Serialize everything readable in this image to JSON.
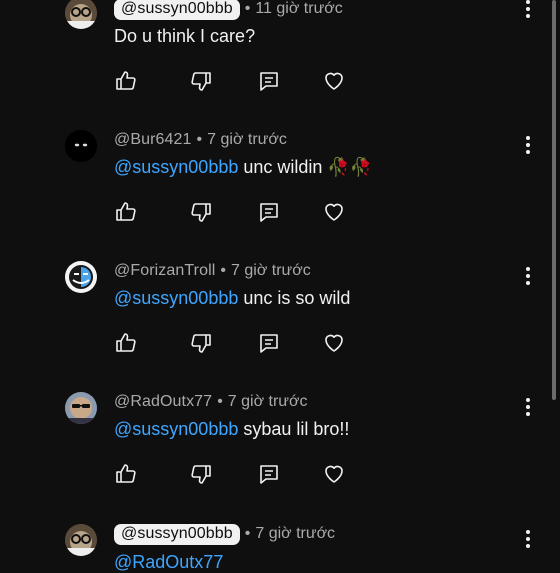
{
  "comments": [
    {
      "handle": "@sussyn00bbb",
      "handle_pill": true,
      "time": "11 giờ trước",
      "text": "Do u think I care?",
      "mention": "",
      "avatar": "avatar-glasses-cat"
    },
    {
      "handle": "@Bur6421",
      "handle_pill": false,
      "time": "7 giờ trước",
      "mention": "@sussyn00bbb",
      "text": "unc wildin 🥀🥀",
      "avatar": "avatar-dark-eyes"
    },
    {
      "handle": "@ForizanTroll",
      "handle_pill": false,
      "time": "7 giờ trước",
      "mention": "@sussyn00bbb",
      "text": "unc is so wild",
      "avatar": "avatar-troll-face"
    },
    {
      "handle": "@RadOutx77",
      "handle_pill": false,
      "time": "7 giờ trước",
      "mention": "@sussyn00bbb",
      "text": " sybau lil bro!!",
      "avatar": "avatar-sunglasses-man"
    },
    {
      "handle": "@sussyn00bbb",
      "handle_pill": true,
      "time": "7 giờ trước",
      "mention": "@RadOutx77",
      "text": "",
      "avatar": "avatar-glasses-cat"
    }
  ],
  "separator": "•",
  "icons": {
    "like": "thumbs-up-icon",
    "dislike": "thumbs-down-icon",
    "reply": "reply-icon",
    "heart": "heart-icon",
    "more": "more-vertical-icon"
  },
  "colors": {
    "background": "#0f0f0f",
    "text": "#f1f1f1",
    "secondary": "#aaaaaa",
    "mention": "#3ea6ff"
  }
}
